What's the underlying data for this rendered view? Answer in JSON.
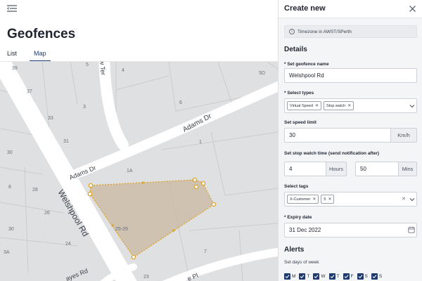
{
  "app": {
    "page_title": "Geofences",
    "tabs": [
      {
        "label": "List",
        "active": false
      },
      {
        "label": "Map",
        "active": true
      }
    ]
  },
  "map": {
    "roads": {
      "welshpool": "Welshpool Rd",
      "adams_upper": "Adams Dr",
      "adams_lower": "Adams Dr",
      "ter": "w Ter",
      "hayes": "ayes Rd",
      "pl": "e Pl"
    },
    "lots": [
      "39",
      "5",
      "4",
      "5D",
      "37",
      "3",
      "6",
      "33",
      "31",
      "1",
      "30",
      "1A",
      "28",
      "26",
      "25-29",
      "24",
      "30",
      "3A",
      "23",
      "7",
      "8"
    ],
    "polygon_color": "#e0a020"
  },
  "panel": {
    "title": "Create new",
    "timezone_note": "Timezone in AWST/SPerth",
    "details_title": "Details",
    "geofence_name_label": "* Set geofence name",
    "geofence_name_value": "Welshpool Rd",
    "types_label": "* Select types",
    "types": [
      "Virtual Speed",
      "Stop watch"
    ],
    "speed_label": "Set speed limit",
    "speed_value": "30",
    "speed_unit": "Km/h",
    "stopwatch_label": "Set stop watch time (send notification after)",
    "hours_value": "4",
    "hours_unit": "Hours",
    "mins_value": "50",
    "mins_unit": "Mins",
    "tags_label": "Select tags",
    "tags": [
      "X-Customer",
      "5"
    ],
    "expiry_label": "* Expiry date",
    "expiry_value": "31 Dec 2022",
    "alerts_title": "Alerts",
    "days_label": "Set days of week",
    "days": [
      "M",
      "T",
      "W",
      "T",
      "F",
      "S",
      "S"
    ]
  }
}
